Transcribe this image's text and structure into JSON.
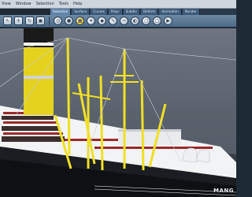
{
  "app": {
    "title": ""
  },
  "menubar": {
    "items": [
      "View",
      "Window",
      "Selection",
      "Tools",
      "Help"
    ]
  },
  "tabs": {
    "items": [
      "Selection",
      "Surface",
      "Curves",
      "Polys",
      "Subdiv",
      "Deform",
      "Animation",
      "Render"
    ],
    "active_index": 0
  },
  "toolbar": {
    "tools": [
      "select-icon",
      "move-icon",
      "rotate-icon",
      "scale-icon",
      "snap-icon",
      "camera-icon",
      "grid-icon",
      "light-icon",
      "mesh-icon",
      "brush-icon",
      "cut-icon",
      "paint-icon",
      "sphere-icon",
      "cube-icon",
      "render-icon"
    ]
  },
  "viewport": {
    "watermark": "MANG",
    "colors": {
      "sky": "#5e6670",
      "hull": "#ffffff",
      "stripe": "#9b2a2a",
      "funnel": "#e5d21f",
      "mast": "#f0e024"
    }
  }
}
